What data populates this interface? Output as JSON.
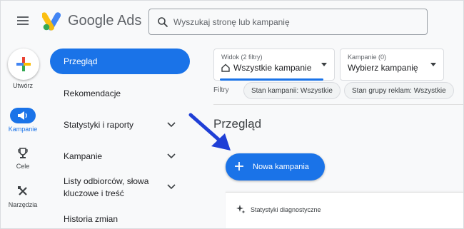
{
  "header": {
    "app_name": "Google Ads",
    "search_placeholder": "Wyszukaj stronę lub kampanię",
    "logo_colors": {
      "blue": "#4285f4",
      "yellow": "#fbbc04",
      "green": "#34a853"
    }
  },
  "rail": {
    "create_label": "Utwórz",
    "items": [
      {
        "label": "Kampanie",
        "icon": "megaphone-icon",
        "active": true
      },
      {
        "label": "Cele",
        "icon": "trophy-icon",
        "active": false
      },
      {
        "label": "Narzędzia",
        "icon": "tools-icon",
        "active": false
      }
    ]
  },
  "nav": {
    "items": [
      {
        "label": "Przegląd",
        "active": true,
        "expandable": false
      },
      {
        "label": "Rekomendacje",
        "active": false,
        "expandable": false
      },
      {
        "label": "Statystyki i raporty",
        "active": false,
        "expandable": true
      },
      {
        "label": "Kampanie",
        "active": false,
        "expandable": true
      },
      {
        "label_line1": "Listy odbiorców, słowa",
        "label_line2": "kluczowe i treść",
        "active": false,
        "expandable": true
      },
      {
        "label": "Historia zmian",
        "active": false,
        "expandable": false
      }
    ]
  },
  "main": {
    "view_dropdown": {
      "caption": "Widok (2 filtry)",
      "value": "Wszystkie kampanie"
    },
    "campaign_dropdown": {
      "caption": "Kampanie (0)",
      "value": "Wybierz kampanię"
    },
    "filters_label": "Filtry",
    "filter_chips": [
      "Stan kampanii: Wszystkie",
      "Stan grupy reklam: Wszystkie"
    ],
    "page_title": "Przegląd",
    "new_campaign_label": "Nowa kampania",
    "diagnostics_label": "Statystyki diagnostyczne"
  },
  "colors": {
    "accent": "#1a73e8",
    "arrow": "#1f3fd6"
  }
}
